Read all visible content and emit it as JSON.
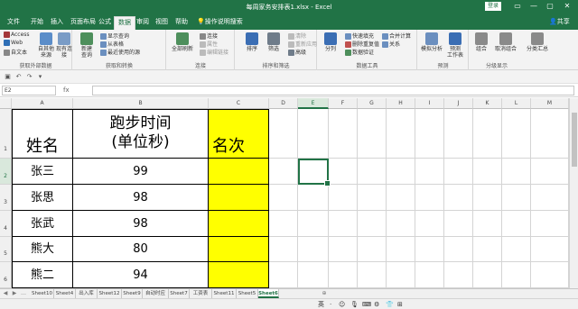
{
  "window": {
    "title": "每周家务安排表1.xlsx  -  Excel",
    "login_label": "登录",
    "controls": [
      "▭",
      "—",
      "▢",
      "✕"
    ]
  },
  "ribbon_tabs": [
    "文件",
    "开始",
    "插入",
    "页面布局",
    "公式",
    "数据",
    "审阅",
    "视图",
    "帮助"
  ],
  "tell_me": "操作说明搜索",
  "share_label": "共享",
  "ribbon": {
    "get_external": {
      "label": "获取外部数据",
      "items": [
        "Access",
        "Web",
        "自文本"
      ],
      "big1": "自其他来源",
      "big2": "现有连接"
    },
    "get_transform": {
      "label": "获取和转换",
      "big": "新建\n查询",
      "items": [
        "显示查询",
        "从表格",
        "最近使用的源"
      ]
    },
    "connections": {
      "label": "连接",
      "big": "全部刷新",
      "items": [
        "连接",
        "属性",
        "编辑链接"
      ]
    },
    "sort_filter": {
      "label": "排序和筛选",
      "buttons": [
        "排序",
        "筛选"
      ],
      "items": [
        "清除",
        "重新应用",
        "高级"
      ]
    },
    "data_tools": {
      "label": "数据工具",
      "big": "分列",
      "items": [
        "快速填充",
        "删除重复值",
        "数据验证",
        "合并计算",
        "关系"
      ]
    },
    "forecast": {
      "label": "预测",
      "buttons": [
        "模拟分析",
        "预测\n工作表"
      ]
    },
    "outline": {
      "label": "分级显示",
      "buttons": [
        "组合",
        "取消组合",
        "分类汇总"
      ]
    }
  },
  "name_box": "E2",
  "fx_label": "fx",
  "columns": [
    "A",
    "B",
    "C",
    "D",
    "E",
    "F",
    "G",
    "H",
    "I",
    "J",
    "K",
    "L",
    "M"
  ],
  "rows": [
    "1",
    "2",
    "3",
    "4",
    "5",
    "6",
    "7"
  ],
  "table": {
    "header_name": "姓名",
    "header_time_line1": "跑步时间",
    "header_time_line2": "(单位秒)",
    "header_rank": "名次",
    "names": [
      "张三",
      "张思",
      "张武",
      "熊大",
      "熊二"
    ],
    "times": [
      "99",
      "98",
      "98",
      "80",
      "94"
    ]
  },
  "sheet_tabs": [
    "Sheet10",
    "Sheet4",
    "出入库",
    "Sheet12",
    "Sheet9",
    "自动时应",
    "Sheet7",
    "工资表",
    "Sheet11",
    "Sheet5",
    "Sheet6"
  ],
  "active_sheet": "Sheet6",
  "status": {
    "ime_lang": "英",
    "ime_icons": [
      "·",
      "☺",
      "🎙",
      "⌨",
      "⚙",
      "👕",
      "⊞"
    ]
  },
  "colors": {
    "excel_green": "#217346",
    "highlight": "#ffff00"
  }
}
